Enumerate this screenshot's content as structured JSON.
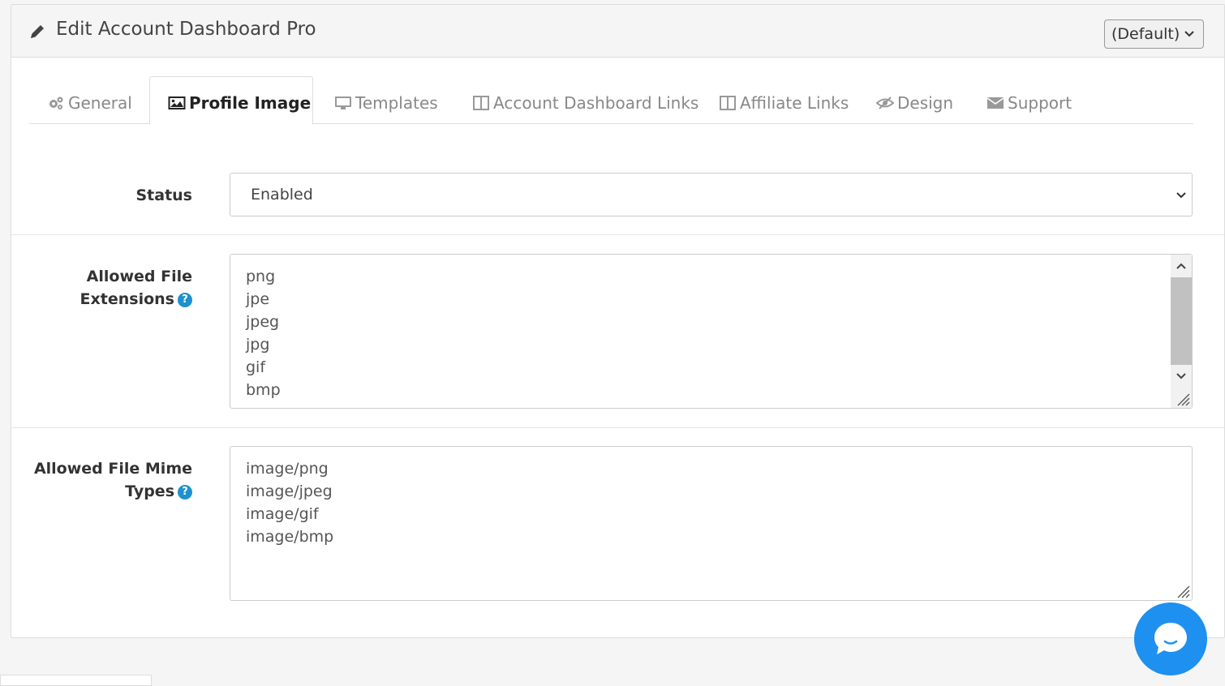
{
  "header": {
    "title": "Edit Account Dashboard Pro",
    "store_select": "(Default)"
  },
  "tabs": [
    {
      "label": "General",
      "icon": "cogs-icon",
      "active": false
    },
    {
      "label": "Profile Image",
      "icon": "image-icon",
      "active": true
    },
    {
      "label": "Templates",
      "icon": "desktop-icon",
      "active": false
    },
    {
      "label": "Account Dashboard Links",
      "icon": "columns-icon",
      "active": false
    },
    {
      "label": "Affiliate Links",
      "icon": "columns-icon",
      "active": false
    },
    {
      "label": "Design",
      "icon": "eye-slash-icon",
      "active": false
    },
    {
      "label": "Support",
      "icon": "envelope-icon",
      "active": false
    }
  ],
  "form": {
    "status": {
      "label": "Status",
      "value": "Enabled"
    },
    "extensions": {
      "label_line1": "Allowed File",
      "label_line2": "Extensions",
      "help": "?",
      "values": [
        "png",
        "jpe",
        "jpeg",
        "jpg",
        "gif",
        "bmp"
      ]
    },
    "mime": {
      "label_line1": "Allowed File Mime",
      "label_line2": "Types",
      "help": "?",
      "values": [
        "image/png",
        "image/jpeg",
        "image/gif",
        "image/bmp"
      ]
    }
  },
  "colors": {
    "accent": "#1e91cf",
    "chat": "#1e90f0"
  }
}
